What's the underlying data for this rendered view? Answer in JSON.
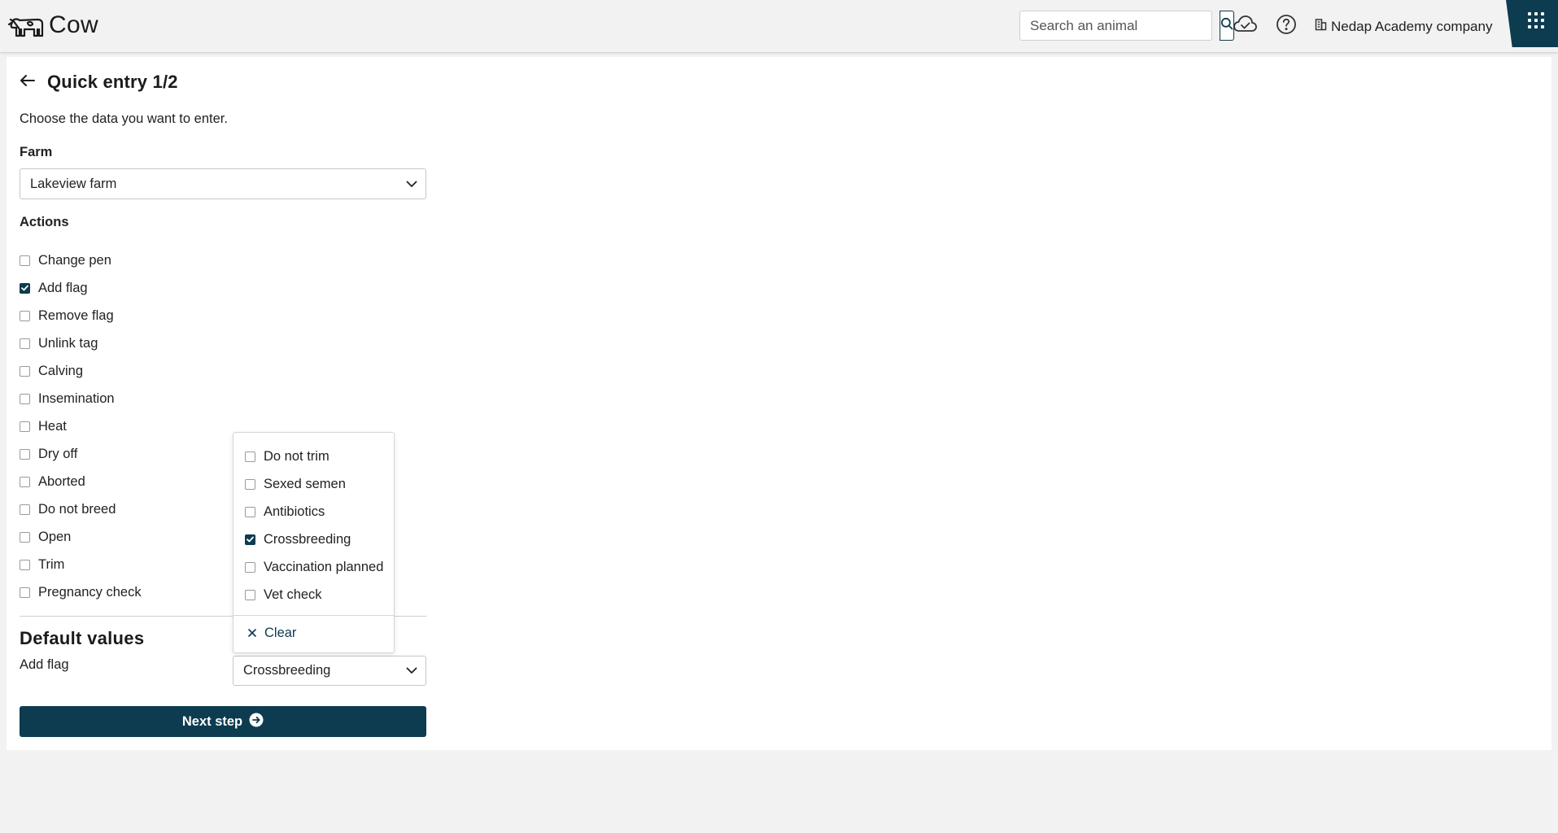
{
  "header": {
    "app_name": "Cow",
    "search_placeholder": "Search an animal",
    "company": "Nedap Academy company"
  },
  "page": {
    "title": "Quick entry 1/2",
    "subtitle": "Choose the data you want to enter.",
    "farm_label": "Farm",
    "farm_value": "Lakeview farm",
    "actions_label": "Actions",
    "actions": [
      {
        "label": "Change pen",
        "checked": false
      },
      {
        "label": "Add flag",
        "checked": true
      },
      {
        "label": "Remove flag",
        "checked": false
      },
      {
        "label": "Unlink tag",
        "checked": false
      },
      {
        "label": "Calving",
        "checked": false
      },
      {
        "label": "Insemination",
        "checked": false
      },
      {
        "label": "Heat",
        "checked": false
      },
      {
        "label": "Dry off",
        "checked": false
      },
      {
        "label": "Aborted",
        "checked": false
      },
      {
        "label": "Do not breed",
        "checked": false
      },
      {
        "label": "Open",
        "checked": false
      },
      {
        "label": "Trim",
        "checked": false
      },
      {
        "label": "Pregnancy check",
        "checked": false
      }
    ],
    "default_values_title": "Default values",
    "add_flag_label": "Add flag",
    "add_flag_value": "Crossbreeding",
    "next_step_label": "Next step"
  },
  "flag_dropdown": {
    "options": [
      {
        "label": "Do not trim",
        "checked": false
      },
      {
        "label": "Sexed semen",
        "checked": false
      },
      {
        "label": "Antibiotics",
        "checked": false
      },
      {
        "label": "Crossbreeding",
        "checked": true
      },
      {
        "label": "Vaccination planned",
        "checked": false
      },
      {
        "label": "Vet check",
        "checked": false
      }
    ],
    "clear_label": "Clear"
  },
  "colors": {
    "primary": "#0d3b4f",
    "background": "#f2f2f2",
    "card": "#ffffff"
  }
}
